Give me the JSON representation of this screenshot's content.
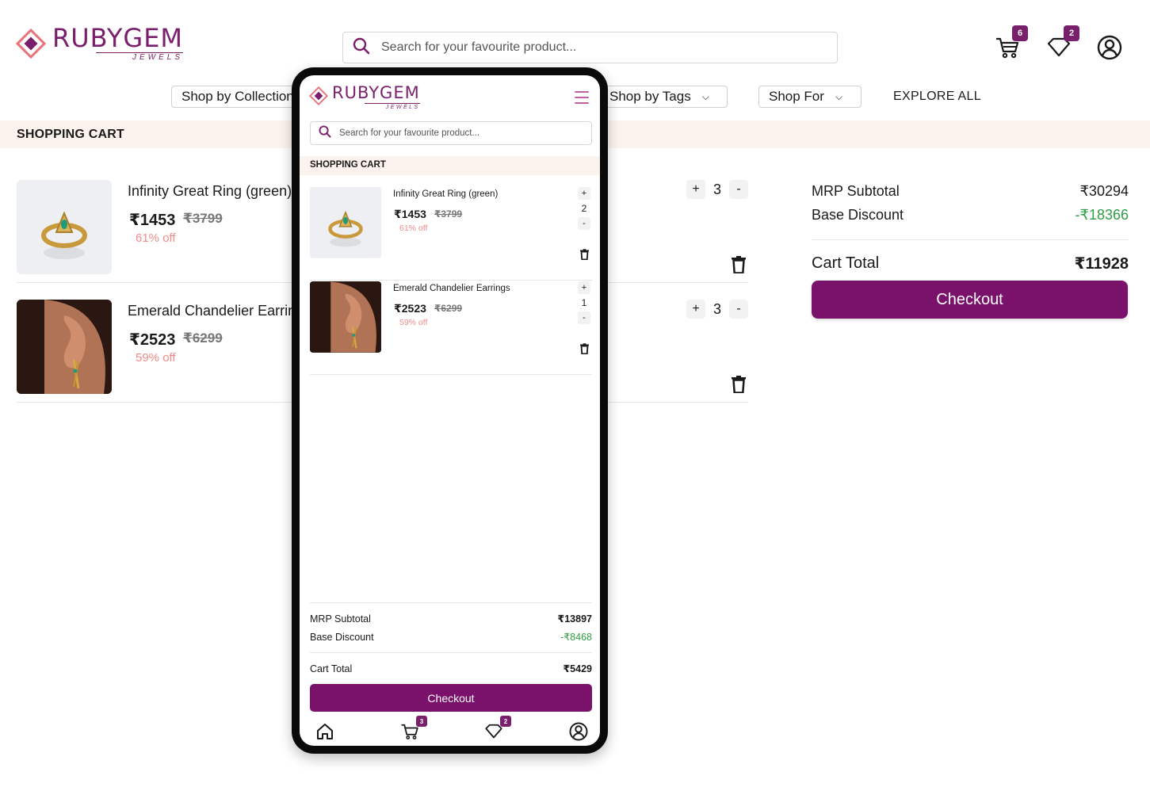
{
  "brand": {
    "name": "RUBYGEM",
    "sub": "JEWELS"
  },
  "search": {
    "placeholder": "Search for your favourite product..."
  },
  "header": {
    "cart_count": "6",
    "wishlist_count": "2"
  },
  "nav": {
    "shop_by_collection": "Shop by Collection",
    "shop_by_tags": "Shop by Tags",
    "shop_for": "Shop For",
    "explore_all": "EXPLORE ALL"
  },
  "cart": {
    "title": "SHOPPING CART",
    "items": [
      {
        "name": "Infinity Great Ring (green)",
        "price": "₹1453",
        "mrp": "₹3799",
        "off": "61% off",
        "qty": "3",
        "image": "ring"
      },
      {
        "name": "Emerald Chandelier Earrings",
        "price": "₹2523",
        "mrp": "₹6299",
        "off": "59% off",
        "qty": "3",
        "image": "earring"
      }
    ],
    "plus": "+",
    "minus": "-"
  },
  "summary": {
    "mrp_label": "MRP Subtotal",
    "mrp_value": "₹30294",
    "discount_label": "Base Discount",
    "discount_value": "-₹18366",
    "total_label": "Cart Total",
    "total_value": "₹11928",
    "checkout": "Checkout"
  },
  "mobile": {
    "search_placeholder": "Search for your favourite product...",
    "cart_title": "SHOPPING CART",
    "items": [
      {
        "name": "Infinity Great Ring (green)",
        "price": "₹1453",
        "mrp": "₹3799",
        "off": "61% off",
        "qty": "2"
      },
      {
        "name": "Emerald Chandelier Earrings",
        "price": "₹2523",
        "mrp": "₹6299",
        "off": "59% off",
        "qty": "1"
      }
    ],
    "summary": {
      "mrp_label": "MRP Subtotal",
      "mrp_value": "₹13897",
      "discount_label": "Base Discount",
      "discount_value": "-₹8468",
      "total_label": "Cart Total",
      "total_value": "₹5429",
      "checkout": "Checkout"
    },
    "tabbar": {
      "cart_count": "3",
      "wishlist_count": "2"
    }
  },
  "colors": {
    "brand": "#7a126b",
    "band": "#fdf3ee",
    "discount": "#2f9e44",
    "off": "#f08b8b"
  }
}
